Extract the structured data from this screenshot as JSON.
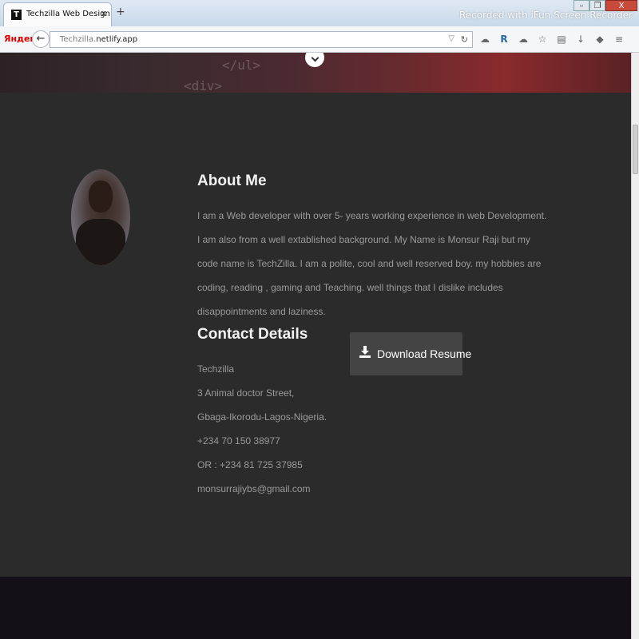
{
  "browser": {
    "tab_title": "Techzilla Web Design",
    "tab_close": "x",
    "new_tab": "+",
    "watermark": "Recorded with iFun Screen Recorder",
    "window_buttons": {
      "minimize": "–",
      "restore": "❐",
      "close": "X"
    },
    "search_brand": "Яндекс",
    "url_host": "Techzilla.",
    "url_domain": "netlify.app",
    "toolbar_icons": [
      "cloud-icon",
      "reader-icon",
      "weather-icon",
      "bookmark-star-icon",
      "clipboard-icon",
      "download-icon",
      "pocket-icon",
      "menu-icon"
    ]
  },
  "hero": {
    "code_snippet_1": "</ul>",
    "code_snippet_2": "<div>"
  },
  "about": {
    "heading": "About Me",
    "text": "I am a Web developer with over 5- years working experience in web Development. I am also from a well extablished background. My Name is Monsur Raji but my code name is TechZilla. I am a polite, cool and well reserved boy. my hobbies are coding, reading , gaming and Teaching. well things that I dislike includes disappointments and laziness."
  },
  "contact": {
    "heading": "Contact Details",
    "lines": [
      "Techzilla",
      "3 Animal doctor Street,",
      "Gbaga-Ikorodu-Lagos-Nigeria.",
      "+234 70 150 38977",
      "OR : +234 81 725 37985",
      "monsurrajiybs@gmail.com"
    ]
  },
  "resume": {
    "button_label": "Download Resume"
  },
  "colors": {
    "section_bg": "#2b2b2b",
    "footer_bg": "#150f17",
    "button_bg": "#444444",
    "heading": "#f2f2f2",
    "body_text": "#9a9a9a"
  }
}
